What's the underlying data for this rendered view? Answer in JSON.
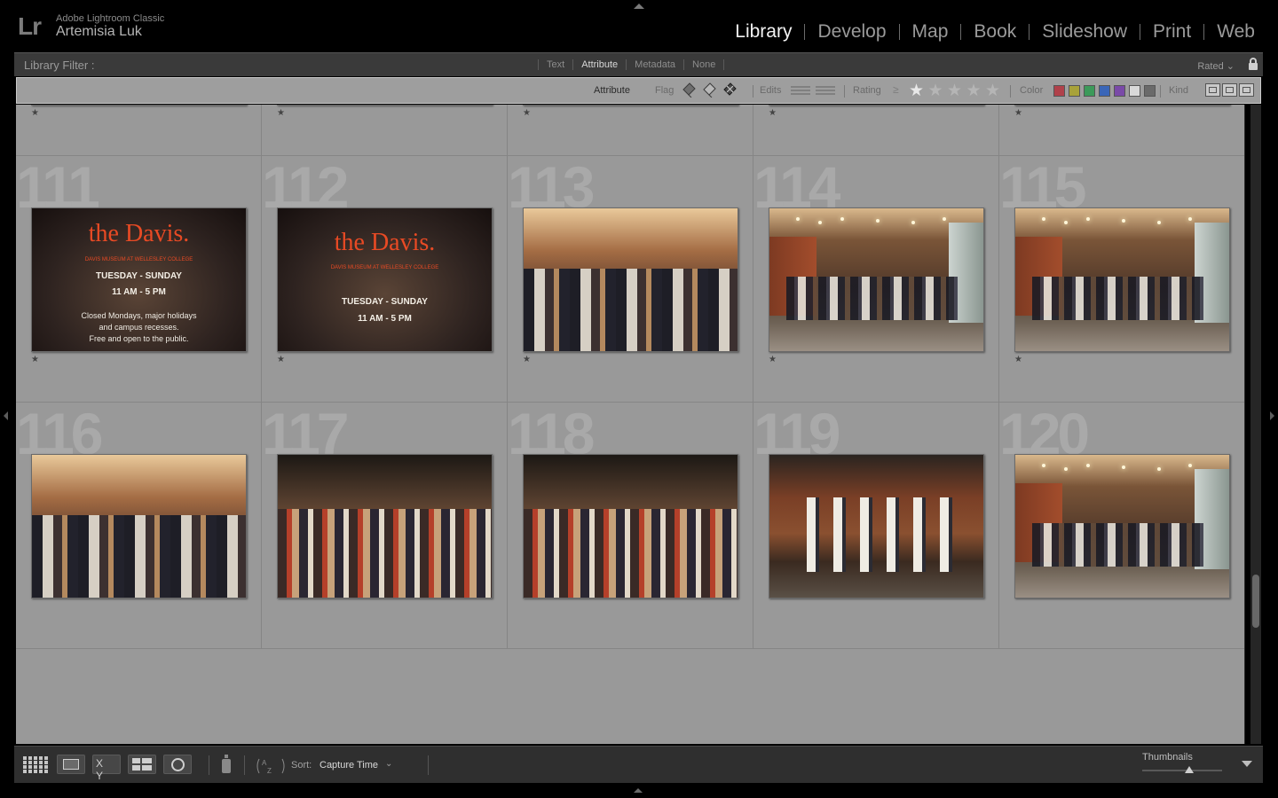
{
  "app": {
    "logo": "Lr",
    "name": "Adobe Lightroom Classic",
    "user": "Artemisia Luk"
  },
  "modules": [
    "Library",
    "Develop",
    "Map",
    "Book",
    "Slideshow",
    "Print",
    "Web"
  ],
  "active_module": "Library",
  "filter_bar": {
    "label": "Library Filter :",
    "tabs": [
      "Text",
      "Attribute",
      "Metadata",
      "None"
    ],
    "active_tab": "Attribute",
    "preset": "Rated",
    "preset_chevron": "⌄",
    "lock_icon": "lock-icon"
  },
  "attribute_bar": {
    "title": "Attribute",
    "flag_label": "Flag",
    "edits_label": "Edits",
    "rating_label": "Rating",
    "rating_operator": "≥",
    "rating_value": 1,
    "rating_max": 5,
    "color_label": "Color",
    "colors": [
      "#b0414a",
      "#a8a23a",
      "#3c9a5a",
      "#3a66b8",
      "#7a4aa8",
      "#d9d9d9",
      "#6a6a6a"
    ],
    "kind_label": "Kind"
  },
  "grid": {
    "cells": [
      {
        "num": "",
        "star": "★",
        "scene": "pumpkin"
      },
      {
        "num": "",
        "star": "★",
        "scene": "pumpkin"
      },
      {
        "num": "",
        "star": "★",
        "scene": "warm"
      },
      {
        "num": "",
        "star": "★",
        "scene": "warm"
      },
      {
        "num": "",
        "star": "★",
        "scene": "night"
      },
      {
        "num": "111",
        "star": "★",
        "scene": "sign1"
      },
      {
        "num": "112",
        "star": "★",
        "scene": "sign2"
      },
      {
        "num": "113",
        "star": "★",
        "scene": "lobby"
      },
      {
        "num": "114",
        "star": "★",
        "scene": "warm"
      },
      {
        "num": "115",
        "star": "★",
        "scene": "warm"
      },
      {
        "num": "116",
        "star": "",
        "scene": "lobby"
      },
      {
        "num": "117",
        "star": "",
        "scene": "seated"
      },
      {
        "num": "118",
        "star": "",
        "scene": "seated"
      },
      {
        "num": "119",
        "star": "",
        "scene": "court"
      },
      {
        "num": "120",
        "star": "",
        "scene": "warm"
      }
    ],
    "sign": {
      "big": "the Davis.",
      "line1": "DAVIS MUSEUM AT WELLESLEY COLLEGE",
      "days": "TUESDAY - SUNDAY",
      "hours": "11 AM - 5 PM",
      "note1": "Closed Mondays, major holidays",
      "note2": "and campus recesses.",
      "note3": "Free and open to the public."
    }
  },
  "toolbar": {
    "sort_icon": "sort-az-icon",
    "sort_label": "Sort:",
    "sort_value": "Capture Time",
    "sort_chevron": "⌄",
    "xy_label": "X Y",
    "thumbnails_label": "Thumbnails"
  }
}
